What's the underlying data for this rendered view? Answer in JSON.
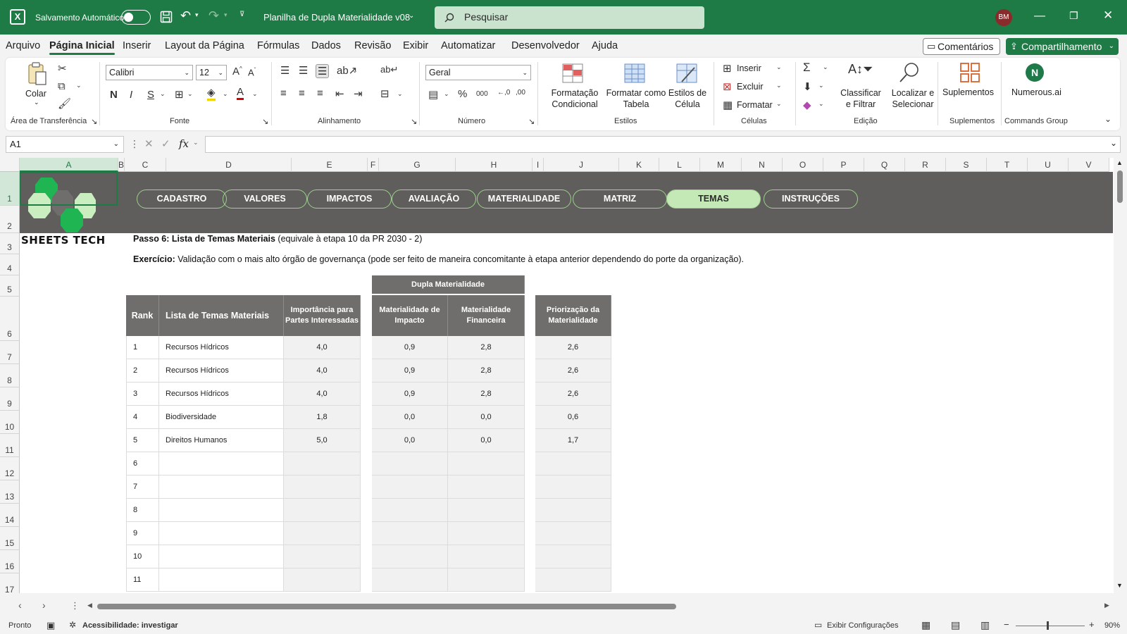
{
  "titlebar": {
    "autosave_label": "Salvamento Automático",
    "doc_title": "Planilha de Dupla Materialidade v08",
    "search_placeholder": "Pesquisar",
    "avatar_initials": "BM"
  },
  "menu": {
    "items": [
      "Arquivo",
      "Página Inicial",
      "Inserir",
      "Layout da Página",
      "Fórmulas",
      "Dados",
      "Revisão",
      "Exibir",
      "Automatizar",
      "Desenvolvedor",
      "Ajuda"
    ],
    "active": "Página Inicial",
    "comments_label": "Comentários",
    "share_label": "Compartilhamento"
  },
  "ribbon": {
    "clipboard": {
      "paste_label": "Colar",
      "group_label": "Área de Transferência"
    },
    "font": {
      "font_name": "Calibri",
      "font_size": "12",
      "group_label": "Fonte"
    },
    "alignment": {
      "group_label": "Alinhamento"
    },
    "number": {
      "format": "Geral",
      "group_label": "Número"
    },
    "styles": {
      "conditional": "Formatação Condicional",
      "as_table": "Formatar como Tabela",
      "cell_styles": "Estilos de Célula",
      "group_label": "Estilos"
    },
    "cells": {
      "insert": "Inserir",
      "delete": "Excluir",
      "format": "Formatar",
      "group_label": "Células"
    },
    "editing": {
      "sort_filter": "Classificar e Filtrar",
      "find_select": "Localizar e Selecionar",
      "group_label": "Edição"
    },
    "addins": {
      "label": "Suplementos",
      "group_label": "Suplementos"
    },
    "commands": {
      "label": "Numerous.ai",
      "group_label": "Commands Group"
    }
  },
  "formula_bar": {
    "cell_ref": "A1",
    "fx": "fx",
    "content": ""
  },
  "columns": [
    "A",
    "B",
    "C",
    "D",
    "E",
    "F",
    "G",
    "H",
    "I",
    "J",
    "K",
    "L",
    "M",
    "N",
    "O",
    "P",
    "Q",
    "R",
    "S",
    "T",
    "U",
    "V"
  ],
  "rows": [
    "1",
    "2",
    "3",
    "4",
    "5",
    "6",
    "7",
    "8",
    "9",
    "10",
    "11",
    "12",
    "13",
    "14",
    "15",
    "16",
    "17"
  ],
  "sheet": {
    "brand": "SHEETS TECH",
    "nav_tabs": [
      "CADASTRO",
      "VALORES",
      "IMPACTOS",
      "AVALIAÇÃO",
      "MATERIALIDADE",
      "MATRIZ",
      "TEMAS",
      "INSTRUÇÕES"
    ],
    "active_tab": "TEMAS",
    "step_bold": "Passo 6: Lista de Temas Materiais",
    "step_rest": " (equivale à etapa 10 da PR 2030 - 2)",
    "exercise_bold": "Exercício:",
    "exercise_rest": " Validação com o mais alto órgão de governança (pode ser feito de maneira concomitante à etapa anterior dependendo do porte da organização).",
    "table": {
      "group_header": "Dupla Materialidade",
      "headers": {
        "rank": "Rank",
        "tema": "Lista de Temas Materiais",
        "importancia": "Importância para Partes Interessadas",
        "impacto": "Materialidade de Impacto",
        "financeira": "Materialidade Financeira",
        "priorizacao": "Priorização da Materialidade"
      },
      "rows": [
        {
          "rank": "1",
          "tema": "Recursos Hídricos",
          "importancia": "4,0",
          "impacto": "0,9",
          "financeira": "2,8",
          "priorizacao": "2,6"
        },
        {
          "rank": "2",
          "tema": "Recursos Hídricos",
          "importancia": "4,0",
          "impacto": "0,9",
          "financeira": "2,8",
          "priorizacao": "2,6"
        },
        {
          "rank": "3",
          "tema": "Recursos Hídricos",
          "importancia": "4,0",
          "impacto": "0,9",
          "financeira": "2,8",
          "priorizacao": "2,6"
        },
        {
          "rank": "4",
          "tema": "Biodiversidade",
          "importancia": "1,8",
          "impacto": "0,0",
          "financeira": "0,0",
          "priorizacao": "0,6"
        },
        {
          "rank": "5",
          "tema": "Direitos Humanos",
          "importancia": "5,0",
          "impacto": "0,0",
          "financeira": "0,0",
          "priorizacao": "1,7"
        },
        {
          "rank": "6",
          "tema": "",
          "importancia": "",
          "impacto": "",
          "financeira": "",
          "priorizacao": ""
        },
        {
          "rank": "7",
          "tema": "",
          "importancia": "",
          "impacto": "",
          "financeira": "",
          "priorizacao": ""
        },
        {
          "rank": "8",
          "tema": "",
          "importancia": "",
          "impacto": "",
          "financeira": "",
          "priorizacao": ""
        },
        {
          "rank": "9",
          "tema": "",
          "importancia": "",
          "impacto": "",
          "financeira": "",
          "priorizacao": ""
        },
        {
          "rank": "10",
          "tema": "",
          "importancia": "",
          "impacto": "",
          "financeira": "",
          "priorizacao": ""
        },
        {
          "rank": "11",
          "tema": "",
          "importancia": "",
          "impacto": "",
          "financeira": "",
          "priorizacao": ""
        }
      ]
    }
  },
  "statusbar": {
    "ready": "Pronto",
    "accessibility": "Acessibilidade: investigar",
    "display_settings": "Exibir Configurações",
    "zoom": "90%"
  },
  "colors": {
    "excel_green": "#1e7b45",
    "banner": "#5f5e5c",
    "active_tab": "#c5e8b7",
    "header_fill": "#6f6e6c"
  }
}
